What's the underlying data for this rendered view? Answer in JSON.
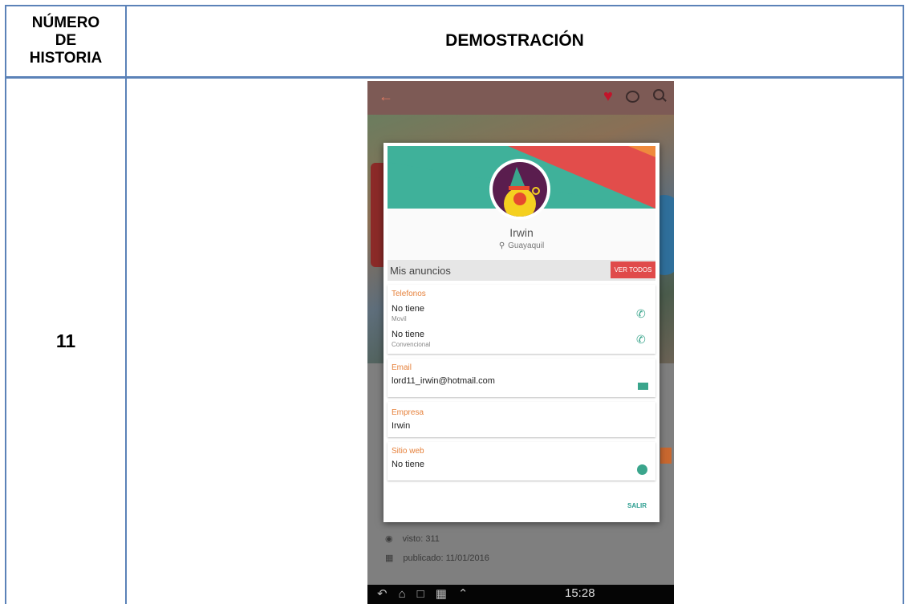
{
  "table": {
    "header_left_lines": [
      "NÚMERO",
      "DE",
      "HISTORIA"
    ],
    "header_right": "DEMOSTRACIÓN",
    "row_number": "11"
  },
  "app": {
    "visits": "visto: 311",
    "published": "publicado: 11/01/2016",
    "time": "15:28"
  },
  "profile": {
    "name": "Irwin",
    "location": "Guayaquil",
    "ads_label": "Mis anuncios",
    "see_all": "VER TODOS"
  },
  "phones": {
    "title": "Telefonos",
    "items": [
      {
        "value": "No tiene",
        "type": "Movil"
      },
      {
        "value": "No tiene",
        "type": "Convencional"
      }
    ]
  },
  "email": {
    "title": "Email",
    "value": "lord11_irwin@hotmail.com"
  },
  "company": {
    "title": "Empresa",
    "value": "Irwin"
  },
  "website": {
    "title": "Sitio web",
    "value": "No tiene"
  },
  "dialog": {
    "exit_label": "SALIR"
  },
  "colors": {
    "accent_orange": "#e6813b",
    "teal": "#3aa58c",
    "red": "#e04a4a",
    "border_blue": "#5b82b8"
  }
}
